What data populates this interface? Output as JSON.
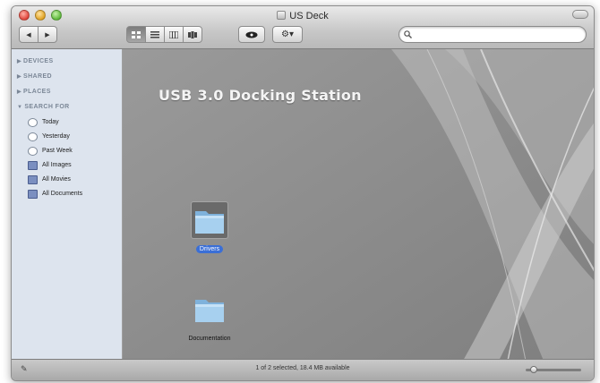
{
  "window": {
    "title": "US Deck"
  },
  "toolbar": {
    "back_glyph": "◀",
    "forward_glyph": "▶",
    "view_icons": [
      "icon-view-icon",
      "list-view-icon",
      "column-view-icon",
      "cover-flow-icon"
    ],
    "active_view_index": 0,
    "quicklook_glyph": "👁",
    "action_glyph": "⚙▾"
  },
  "search": {
    "glyph": "🔍",
    "placeholder": ""
  },
  "sidebar": {
    "sections": [
      {
        "label": "DEVICES",
        "items": []
      },
      {
        "label": "SHARED",
        "items": []
      },
      {
        "label": "PLACES",
        "items": []
      },
      {
        "label": "SEARCH FOR",
        "items": [
          {
            "label": "Today",
            "icon": "clock-icon"
          },
          {
            "label": "Yesterday",
            "icon": "clock-icon"
          },
          {
            "label": "Past Week",
            "icon": "clock-icon"
          },
          {
            "label": "All Images",
            "icon": "smart-folder-icon"
          },
          {
            "label": "All Movies",
            "icon": "smart-folder-icon"
          },
          {
            "label": "All Documents",
            "icon": "smart-folder-icon"
          }
        ]
      }
    ]
  },
  "content": {
    "banner": "USB 3.0 Docking Station",
    "files": [
      {
        "label": "Drivers",
        "selected": true
      },
      {
        "label": "Documentation",
        "selected": false
      }
    ]
  },
  "statusbar": {
    "text": "1 of 2 selected, 18.4 MB available",
    "zoom_level": 0.1
  },
  "colors": {
    "selection": "#3b6fd6",
    "content_bg": "#8f8f8f",
    "sidebar_bg": "#dde4ee"
  }
}
